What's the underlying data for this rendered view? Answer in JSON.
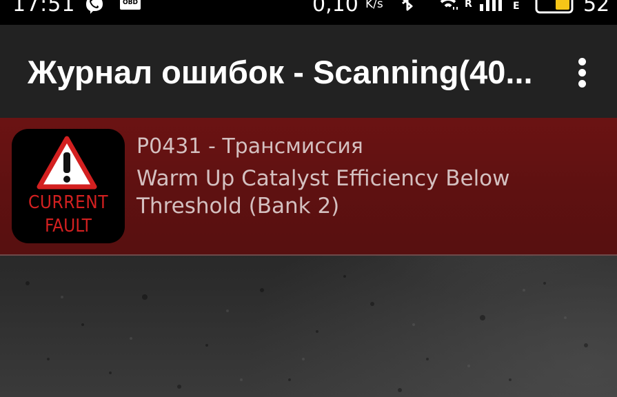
{
  "status_bar": {
    "time": "17:51",
    "obd_label": "OBD",
    "speed_value": "0,10",
    "speed_unit": "K/s",
    "roaming_marker": "R",
    "network_type": "E",
    "battery_level": "52",
    "icons": [
      "viber-icon",
      "obd-icon",
      "bluetooth-icon",
      "wifi-icon",
      "signal-icon",
      "battery-icon"
    ],
    "battery_color": "#f5c518"
  },
  "app_bar": {
    "title": "Журнал ошибок - Scanning(40...",
    "menu_icon": "more-vert-icon"
  },
  "faults": [
    {
      "icon_line1": "CURRENT",
      "icon_line2": "FAULT",
      "code": "P0431 - Трансмиссия",
      "description_line1": "Warm Up Catalyst Efficiency Below",
      "description_line2": "Threshold (Bank 2)",
      "row_color": "#621212",
      "icon_accent": "#d32020"
    }
  ]
}
